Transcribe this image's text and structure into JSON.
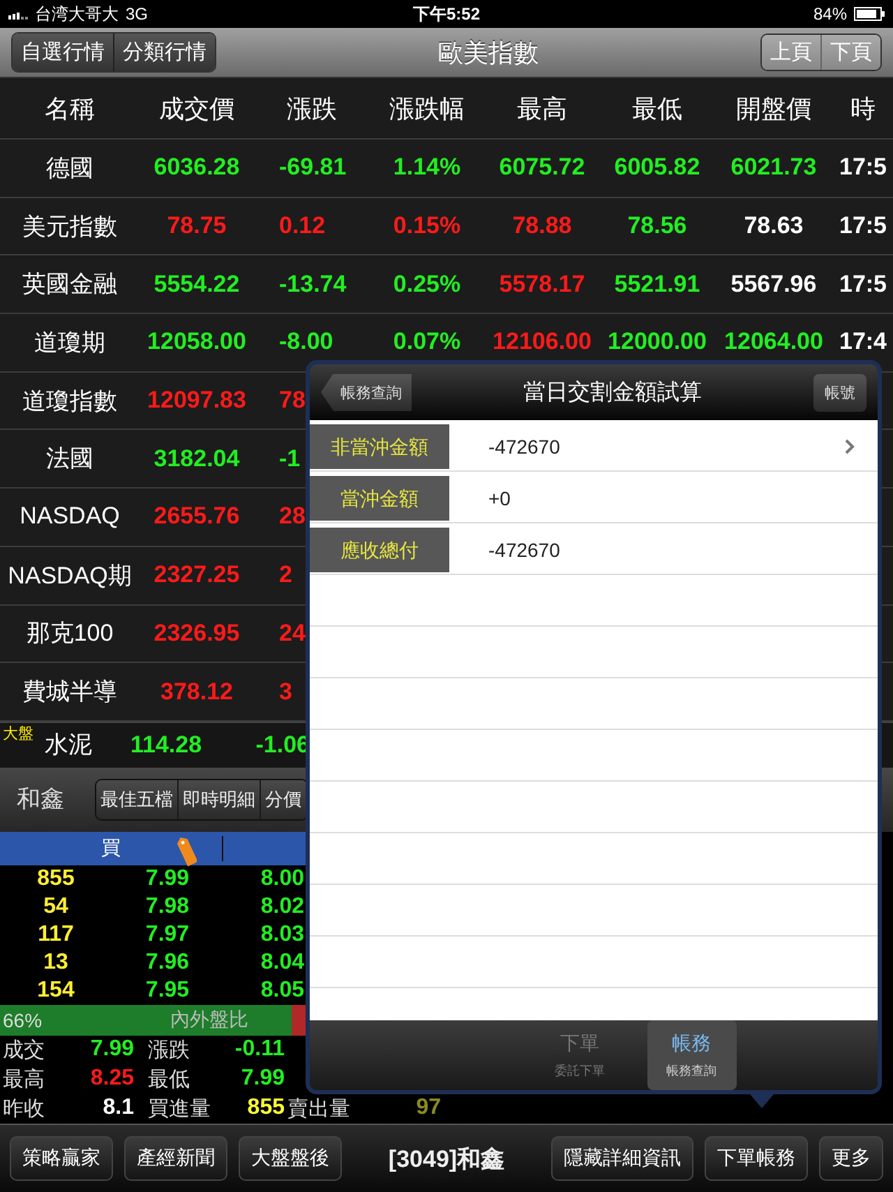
{
  "status_bar": {
    "carrier": "台湾大哥大",
    "network": "3G",
    "time": "下午5:52",
    "battery": "84%"
  },
  "nav_bar": {
    "left_segments": [
      {
        "label": "自選行情"
      },
      {
        "label": "分類行情"
      }
    ],
    "title": "歐美指數",
    "right_segments": [
      {
        "label": "上頁"
      },
      {
        "label": "下頁"
      }
    ]
  },
  "quote_table": {
    "columns": [
      "名稱",
      "成交價",
      "漲跌",
      "漲跌幅",
      "最高",
      "最低",
      "開盤價",
      "時"
    ],
    "rows": [
      {
        "cells": [
          {
            "text": "德國"
          },
          {
            "text": "6036.28",
            "color": "#22ee22"
          },
          {
            "text": "-69.81",
            "color": "#22ee22"
          },
          {
            "text": "1.14%",
            "color": "#22ee22"
          },
          {
            "text": "6075.72",
            "color": "#22ee22"
          },
          {
            "text": "6005.82",
            "color": "#22ee22"
          },
          {
            "text": "6021.73",
            "color": "#22ee22"
          },
          {
            "text": "17:5",
            "color": "#ffffff"
          }
        ]
      },
      {
        "cells": [
          {
            "text": "美元指數"
          },
          {
            "text": "78.75",
            "color": "#ff1a1a"
          },
          {
            "text": "0.12",
            "color": "#ff1a1a"
          },
          {
            "text": "0.15%",
            "color": "#ff1a1a"
          },
          {
            "text": "78.88",
            "color": "#ff1a1a"
          },
          {
            "text": "78.56",
            "color": "#22ee22"
          },
          {
            "text": "78.63",
            "color": "#ffffff"
          },
          {
            "text": "17:5",
            "color": "#ffffff"
          }
        ]
      },
      {
        "cells": [
          {
            "text": "英國金融"
          },
          {
            "text": "5554.22",
            "color": "#22ee22"
          },
          {
            "text": "-13.74",
            "color": "#22ee22"
          },
          {
            "text": "0.25%",
            "color": "#22ee22"
          },
          {
            "text": "5578.17",
            "color": "#ff1a1a"
          },
          {
            "text": "5521.91",
            "color": "#22ee22"
          },
          {
            "text": "5567.96",
            "color": "#ffffff"
          },
          {
            "text": "17:5",
            "color": "#ffffff"
          }
        ]
      },
      {
        "cells": [
          {
            "text": "道瓊期"
          },
          {
            "text": "12058.00",
            "color": "#22ee22"
          },
          {
            "text": "-8.00",
            "color": "#22ee22"
          },
          {
            "text": "0.07%",
            "color": "#22ee22"
          },
          {
            "text": "12106.00",
            "color": "#ff1a1a"
          },
          {
            "text": "12000.00",
            "color": "#22ee22"
          },
          {
            "text": "12064.00",
            "color": "#22ee22"
          },
          {
            "text": "17:4",
            "color": "#ffffff"
          }
        ]
      },
      {
        "cells": [
          {
            "text": "道瓊指數"
          },
          {
            "text": "12097.83",
            "color": "#ff1a1a"
          },
          {
            "text": "78",
            "color": "#ff1a1a"
          }
        ]
      },
      {
        "cells": [
          {
            "text": "法國"
          },
          {
            "text": "3182.04",
            "color": "#22ee22"
          },
          {
            "text": "-1",
            "color": "#22ee22"
          }
        ]
      },
      {
        "cells": [
          {
            "text": "NASDAQ"
          },
          {
            "text": "2655.76",
            "color": "#ff1a1a"
          },
          {
            "text": "28",
            "color": "#ff1a1a"
          }
        ]
      },
      {
        "cells": [
          {
            "text": "NASDAQ期"
          },
          {
            "text": "2327.25",
            "color": "#ff1a1a"
          },
          {
            "text": "2",
            "color": "#ff1a1a"
          }
        ]
      },
      {
        "cells": [
          {
            "text": "那克100"
          },
          {
            "text": "2326.95",
            "color": "#ff1a1a"
          },
          {
            "text": "24",
            "color": "#ff1a1a"
          }
        ]
      },
      {
        "cells": [
          {
            "text": "費城半導"
          },
          {
            "text": "378.12",
            "color": "#ff1a1a"
          },
          {
            "text": "3",
            "color": "#ff1a1a"
          }
        ]
      }
    ]
  },
  "ticker": {
    "badge": "大盤",
    "name": "水泥",
    "price": {
      "text": "114.28",
      "color": "#22ee22"
    },
    "change": {
      "text": "-1.06",
      "color": "#22ee22"
    }
  },
  "stock_panel": {
    "name": "和鑫",
    "tabs": [
      {
        "label": "最佳五檔"
      },
      {
        "label": "即時明細"
      },
      {
        "label": "分價"
      }
    ],
    "bid_header": "買",
    "book": [
      {
        "quantity": "855",
        "bid": "7.99",
        "ask": "8.00"
      },
      {
        "quantity": "54",
        "bid": "7.98",
        "ask": "8.02"
      },
      {
        "quantity": "117",
        "bid": "7.97",
        "ask": "8.03"
      },
      {
        "quantity": "13",
        "bid": "7.96",
        "ask": "8.04"
      },
      {
        "quantity": "154",
        "bid": "7.95",
        "ask": "8.05"
      }
    ],
    "ratio": {
      "reading": "66%",
      "label": "內外盤比",
      "level": 0.95
    },
    "stats": [
      [
        {
          "label": "成交",
          "value": "7.99",
          "color": "#22ee22"
        },
        {
          "label": "漲跌",
          "value": "-0.11",
          "color": "#22ee22"
        }
      ],
      [
        {
          "label": "最高",
          "value": "8.25",
          "color": "#ff1a1a"
        },
        {
          "label": "最低",
          "value": "7.99",
          "color": "#22ee22"
        }
      ],
      [
        {
          "label": "昨收",
          "value": "8.1",
          "color": "#ffffff"
        },
        {
          "label": "買進量",
          "value": "855",
          "color": "#ffff33"
        },
        {
          "label": "賣出量",
          "value": "97",
          "color": "#8a8a20"
        }
      ]
    ]
  },
  "popover": {
    "back_button": "帳務查詢",
    "title": "當日交割金額試算",
    "right_button": "帳號",
    "rows": [
      {
        "label": "非當沖金額",
        "value": "-472670",
        "disclosure": true
      },
      {
        "label": "當沖金額",
        "value": "+0",
        "disclosure": false
      },
      {
        "label": "應收總付",
        "value": "-472670",
        "disclosure": false
      }
    ],
    "tabs": [
      {
        "label": "下單",
        "sub": "委託下單",
        "selected": false
      },
      {
        "label": "帳務",
        "sub": "帳務查詢",
        "selected": true
      }
    ]
  },
  "toolbar": {
    "left_buttons": [
      "策略贏家",
      "產經新聞",
      "大盤盤後"
    ],
    "title": "[3049]和鑫",
    "right_buttons": [
      "隱藏詳細資訊",
      "下單帳務",
      "更多"
    ]
  }
}
